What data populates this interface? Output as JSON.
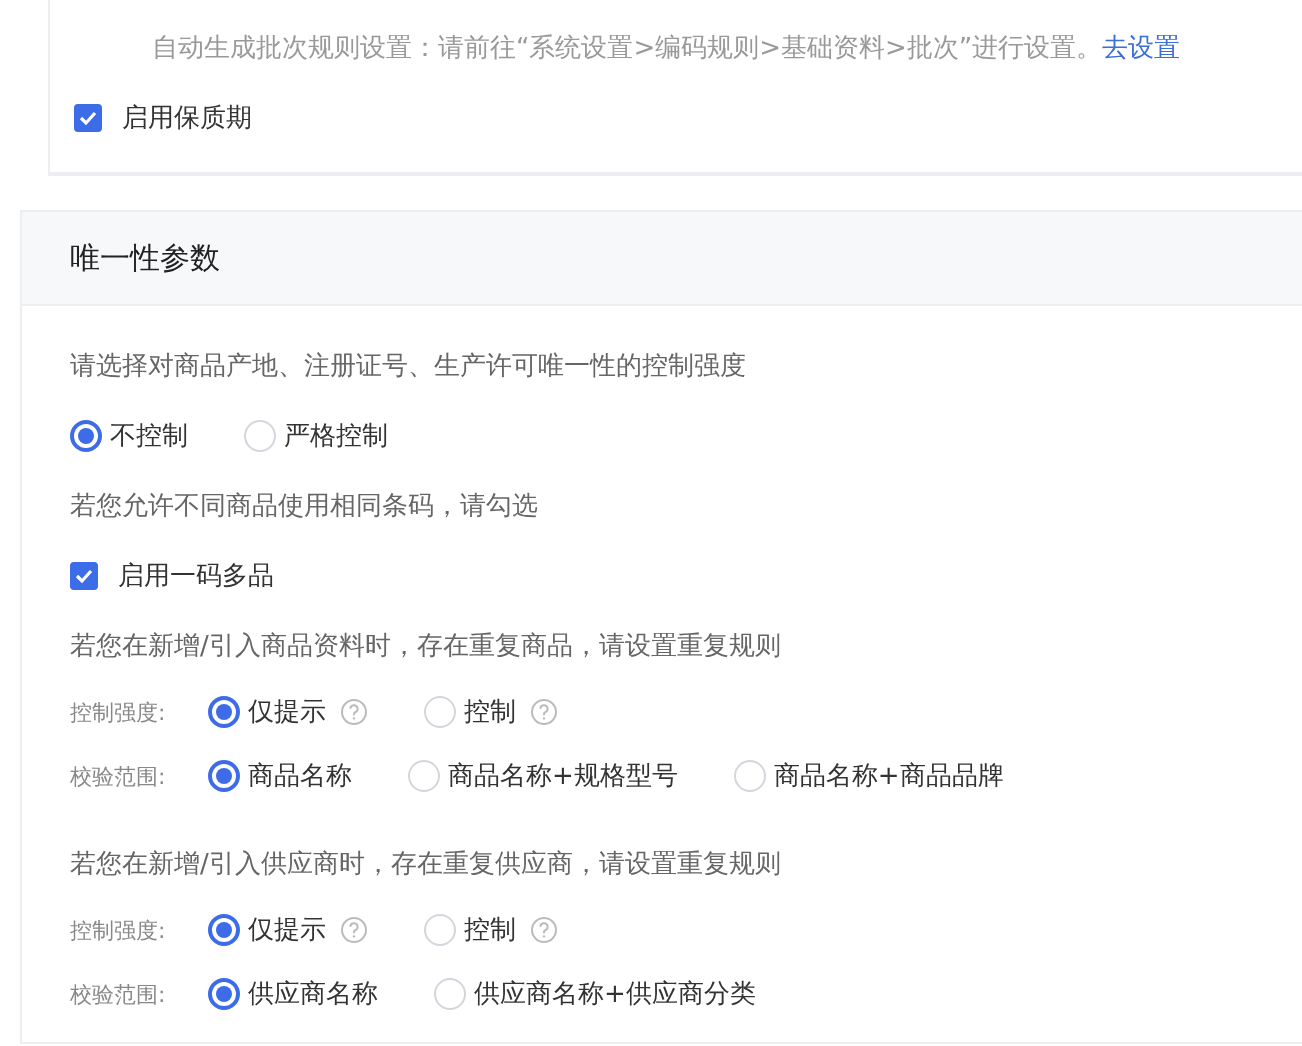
{
  "top": {
    "notice": {
      "text": "自动生成批次规则设置：请前往“系统设置>编码规则>基础资料>批次”进行设置。",
      "link": "去设置"
    },
    "checkbox": {
      "label": "启用保质期",
      "checked": true
    }
  },
  "section": {
    "title": "唯一性参数",
    "items": [
      {
        "kind": "hint",
        "text": "请选择对商品产地、注册证号、生产许可唯一性的控制强度"
      },
      {
        "kind": "radios",
        "options": [
          {
            "label": "不控制",
            "selected": true
          },
          {
            "label": "严格控制",
            "selected": false
          }
        ]
      },
      {
        "kind": "hint",
        "text": "若您允许不同商品使用相同条码，请勾选"
      },
      {
        "kind": "checkbox",
        "label": "启用一码多品",
        "checked": true
      },
      {
        "kind": "hint",
        "text": "若您在新增/引入商品资料时，存在重复商品，请设置重复规则"
      },
      {
        "kind": "field",
        "label": "控制强度:",
        "options": [
          {
            "label": "仅提示",
            "selected": true,
            "help": true
          },
          {
            "label": "控制",
            "selected": false,
            "help": true
          }
        ]
      },
      {
        "kind": "field",
        "label": "校验范围:",
        "options": [
          {
            "label": "商品名称",
            "selected": true,
            "help": false
          },
          {
            "label": "商品名称+规格型号",
            "selected": false,
            "help": false
          },
          {
            "label": "商品名称+商品品牌",
            "selected": false,
            "help": false
          }
        ]
      },
      {
        "kind": "hint",
        "text": "若您在新增/引入供应商时，存在重复供应商，请设置重复规则"
      },
      {
        "kind": "field",
        "label": "控制强度:",
        "options": [
          {
            "label": "仅提示",
            "selected": true,
            "help": true
          },
          {
            "label": "控制",
            "selected": false,
            "help": true
          }
        ]
      },
      {
        "kind": "field",
        "label": "校验范围:",
        "options": [
          {
            "label": "供应商名称",
            "selected": true,
            "help": false
          },
          {
            "label": "供应商名称+供应商分类",
            "selected": false,
            "help": false
          }
        ]
      }
    ]
  }
}
